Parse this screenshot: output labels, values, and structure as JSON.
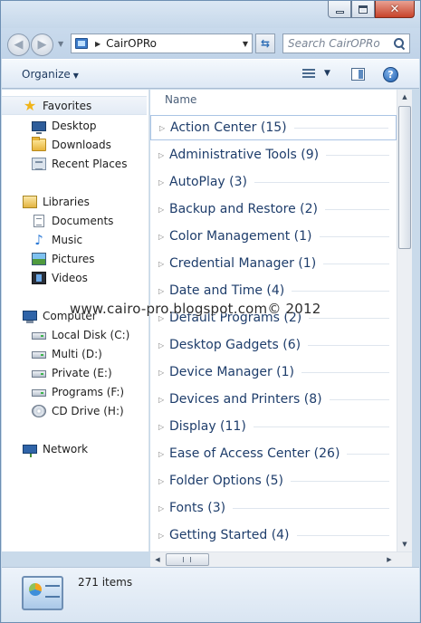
{
  "address": {
    "path": "CairOPRo"
  },
  "search": {
    "placeholder": "Search CairOPRo"
  },
  "toolbar": {
    "organize_label": "Organize"
  },
  "sidebar": {
    "favorites": {
      "label": "Favorites",
      "items": [
        "Desktop",
        "Downloads",
        "Recent Places"
      ]
    },
    "libraries": {
      "label": "Libraries",
      "items": [
        "Documents",
        "Music",
        "Pictures",
        "Videos"
      ]
    },
    "computer": {
      "label": "Computer",
      "items": [
        "Local Disk (C:)",
        "Multi (D:)",
        "Private (E:)",
        "Programs (F:)",
        "CD Drive (H:)"
      ]
    },
    "network": {
      "label": "Network"
    }
  },
  "list": {
    "column_header": "Name",
    "groups": [
      "Action Center (15)",
      "Administrative Tools (9)",
      "AutoPlay (3)",
      "Backup and Restore (2)",
      "Color Management (1)",
      "Credential Manager (1)",
      "Date and Time (4)",
      "Default Programs (2)",
      "Desktop Gadgets (6)",
      "Device Manager (1)",
      "Devices and Printers (8)",
      "Display (11)",
      "Ease of Access Center (26)",
      "Folder Options (5)",
      "Fonts (3)",
      "Getting Started (4)"
    ]
  },
  "status": {
    "item_count": "271 items"
  },
  "watermark": "www.cairo-pro.blogspot.com© 2012",
  "colors": {
    "accent": "#1e3d6b",
    "selection_border": "#aac4e4"
  }
}
